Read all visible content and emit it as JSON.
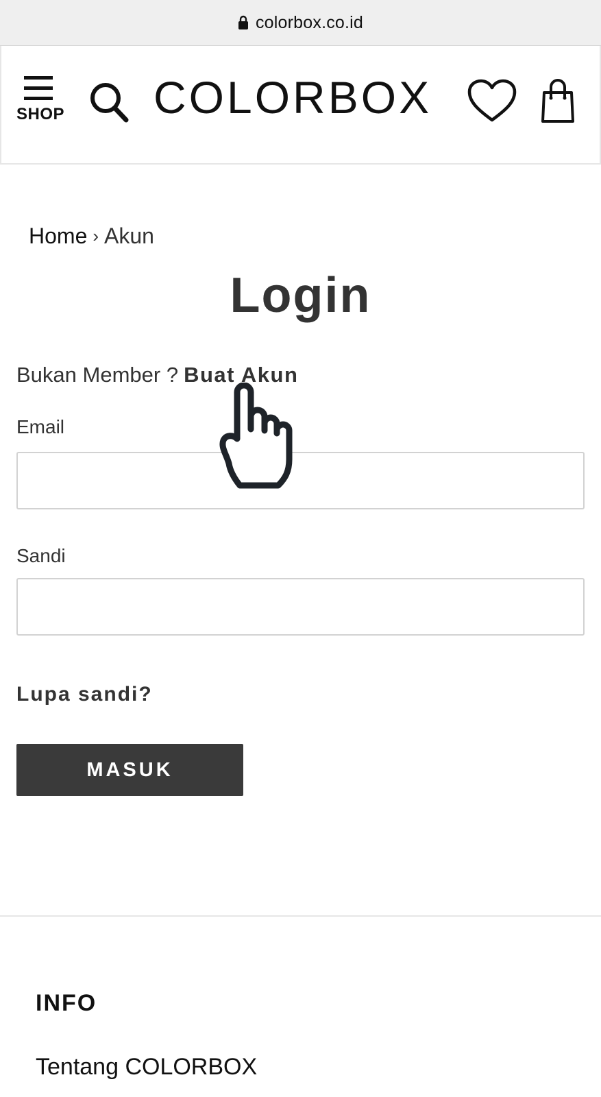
{
  "browser": {
    "url": "colorbox.co.id",
    "lock_icon": "lock-icon"
  },
  "header": {
    "menu_icon": "hamburger-menu-icon",
    "shop_label": "SHOP",
    "search_icon": "search-icon",
    "logo_text": "COLORBOX",
    "wishlist_icon": "heart-icon",
    "bag_icon": "shopping-bag-icon"
  },
  "breadcrumb": {
    "home": "Home",
    "separator": "›",
    "current": "Akun"
  },
  "login": {
    "title": "Login",
    "register_prompt": "Bukan Member ?",
    "register_link": "Buat Akun",
    "email_label": "Email",
    "email_value": "",
    "password_label": "Sandi",
    "password_value": "",
    "forgot_link": "Lupa sandi?",
    "submit_label": "MASUK"
  },
  "footer": {
    "heading": "INFO",
    "links": [
      "Tentang COLORBOX"
    ]
  },
  "colors": {
    "button_bg": "#3a3a3a",
    "text_dark": "#333333",
    "input_border": "#d2d2d2"
  }
}
